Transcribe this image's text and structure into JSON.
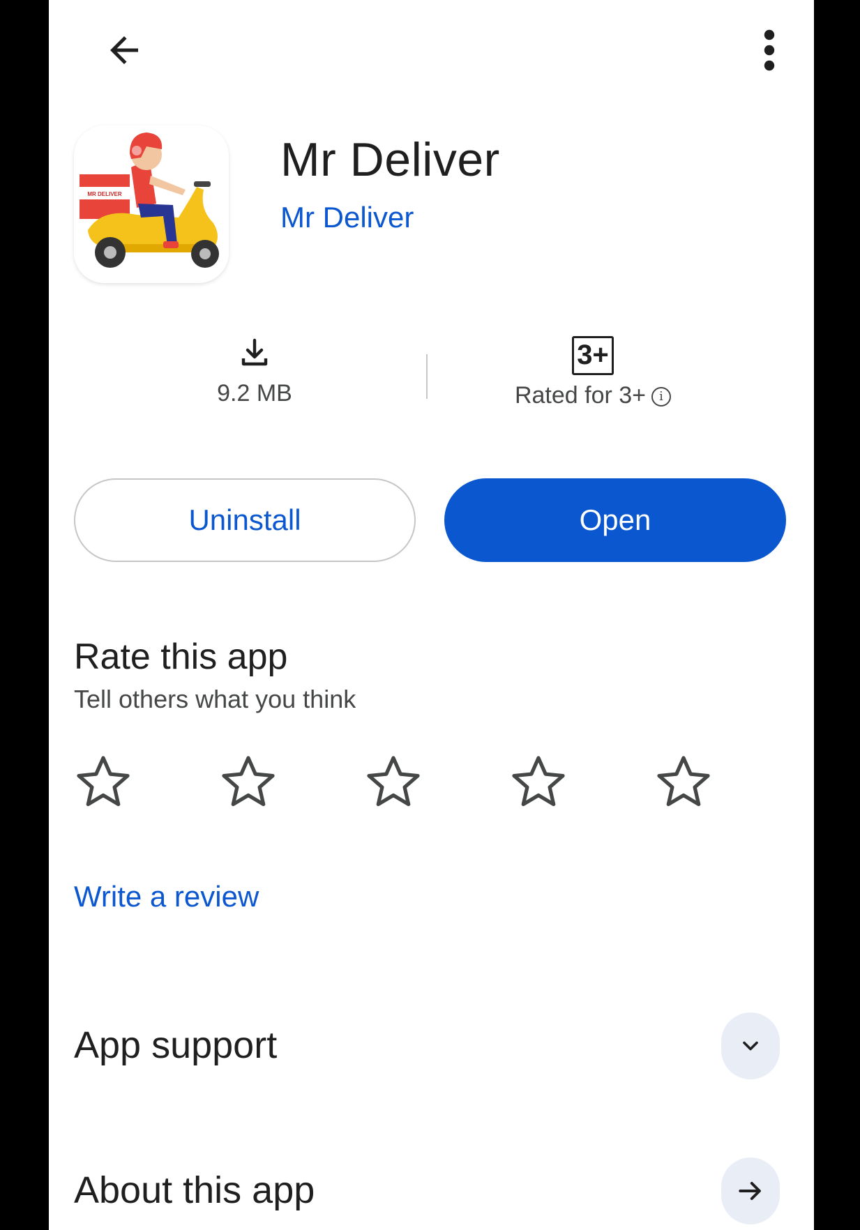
{
  "app": {
    "name": "Mr Deliver",
    "developer": "Mr Deliver",
    "icon_text": "MR DELIVER"
  },
  "stats": {
    "size": "9.2 MB",
    "rating_badge": "3+",
    "rating_label": "Rated for 3+",
    "info_glyph": "i"
  },
  "buttons": {
    "uninstall": "Uninstall",
    "open": "Open"
  },
  "rate": {
    "title": "Rate this app",
    "subtitle": "Tell others what you think",
    "stars": 5,
    "selected": 0,
    "write_review": "Write a review"
  },
  "sections": {
    "app_support": "App support",
    "about_this_app": "About this app"
  },
  "icons": {
    "back": "arrow-left-icon",
    "more": "more-vert-icon",
    "download": "download-icon",
    "star": "star-outline-icon",
    "chevron": "chevron-down-icon",
    "arrow": "arrow-right-icon"
  },
  "colors": {
    "accent": "#0b57d0",
    "text_primary": "#1f1f1f",
    "text_secondary": "#444746",
    "chip_bg": "#e9eef6",
    "frame": "#000000"
  }
}
